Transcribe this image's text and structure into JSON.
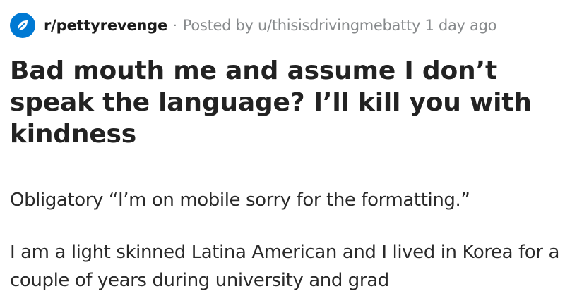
{
  "header": {
    "subreddit": "r/pettyrevenge",
    "separator": "·",
    "posted_by": "Posted by u/thisisdrivingmebatty 1 day ago",
    "icon": "pettyrevenge-subreddit-icon",
    "icon_color": "#0079d3"
  },
  "post": {
    "title": "Bad mouth me and assume I don’t speak the language? I’ll kill you with kindness",
    "paragraphs": [
      "Obligatory “I’m on mobile sorry for the formatting.”",
      "I am a light skinned Latina American and I lived in Korea for a couple of years during university and grad"
    ]
  }
}
